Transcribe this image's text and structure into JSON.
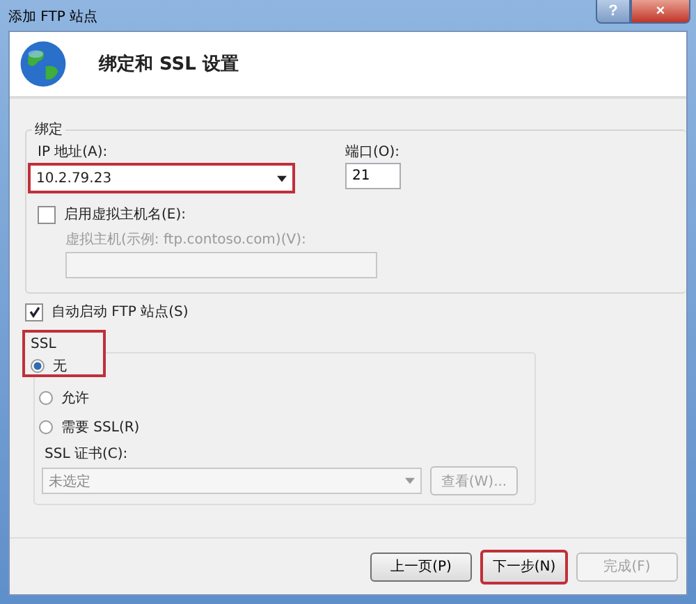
{
  "window": {
    "title": "添加 FTP 站点",
    "help_button": "?",
    "close_button": "×"
  },
  "header": {
    "title": "绑定和 SSL 设置"
  },
  "binding": {
    "legend": "绑定",
    "ip": {
      "label": "IP 地址(A):",
      "value": "10.2.79.23",
      "highlighted": true
    },
    "port": {
      "label": "端口(O):",
      "value": "21"
    },
    "virtual_host": {
      "label": "启用虚拟主机名(E):",
      "checked": false
    },
    "host_name": {
      "label": "虚拟主机(示例: ftp.contoso.com)(V):",
      "disabled": true
    }
  },
  "auto_start": {
    "label": "自动启动 FTP 站点(S)",
    "checked": true
  },
  "ssl": {
    "legend": "SSL",
    "highlighted": true,
    "options": [
      {
        "label": "无",
        "selected": true
      },
      {
        "label": "允许",
        "selected": false
      },
      {
        "label": "需要 SSL(R)",
        "selected": false
      }
    ],
    "certificate": {
      "label": "SSL 证书(C):",
      "value": "未选定",
      "disabled": true
    },
    "view_button": {
      "label": "查看(W)...",
      "disabled": true
    }
  },
  "buttons": [
    {
      "label": "上一页(P)",
      "disabled": false,
      "highlighted": false
    },
    {
      "label": "下一步(N)",
      "disabled": false,
      "highlighted": true
    },
    {
      "label": "完成(F)",
      "disabled": true,
      "highlighted": false
    }
  ]
}
